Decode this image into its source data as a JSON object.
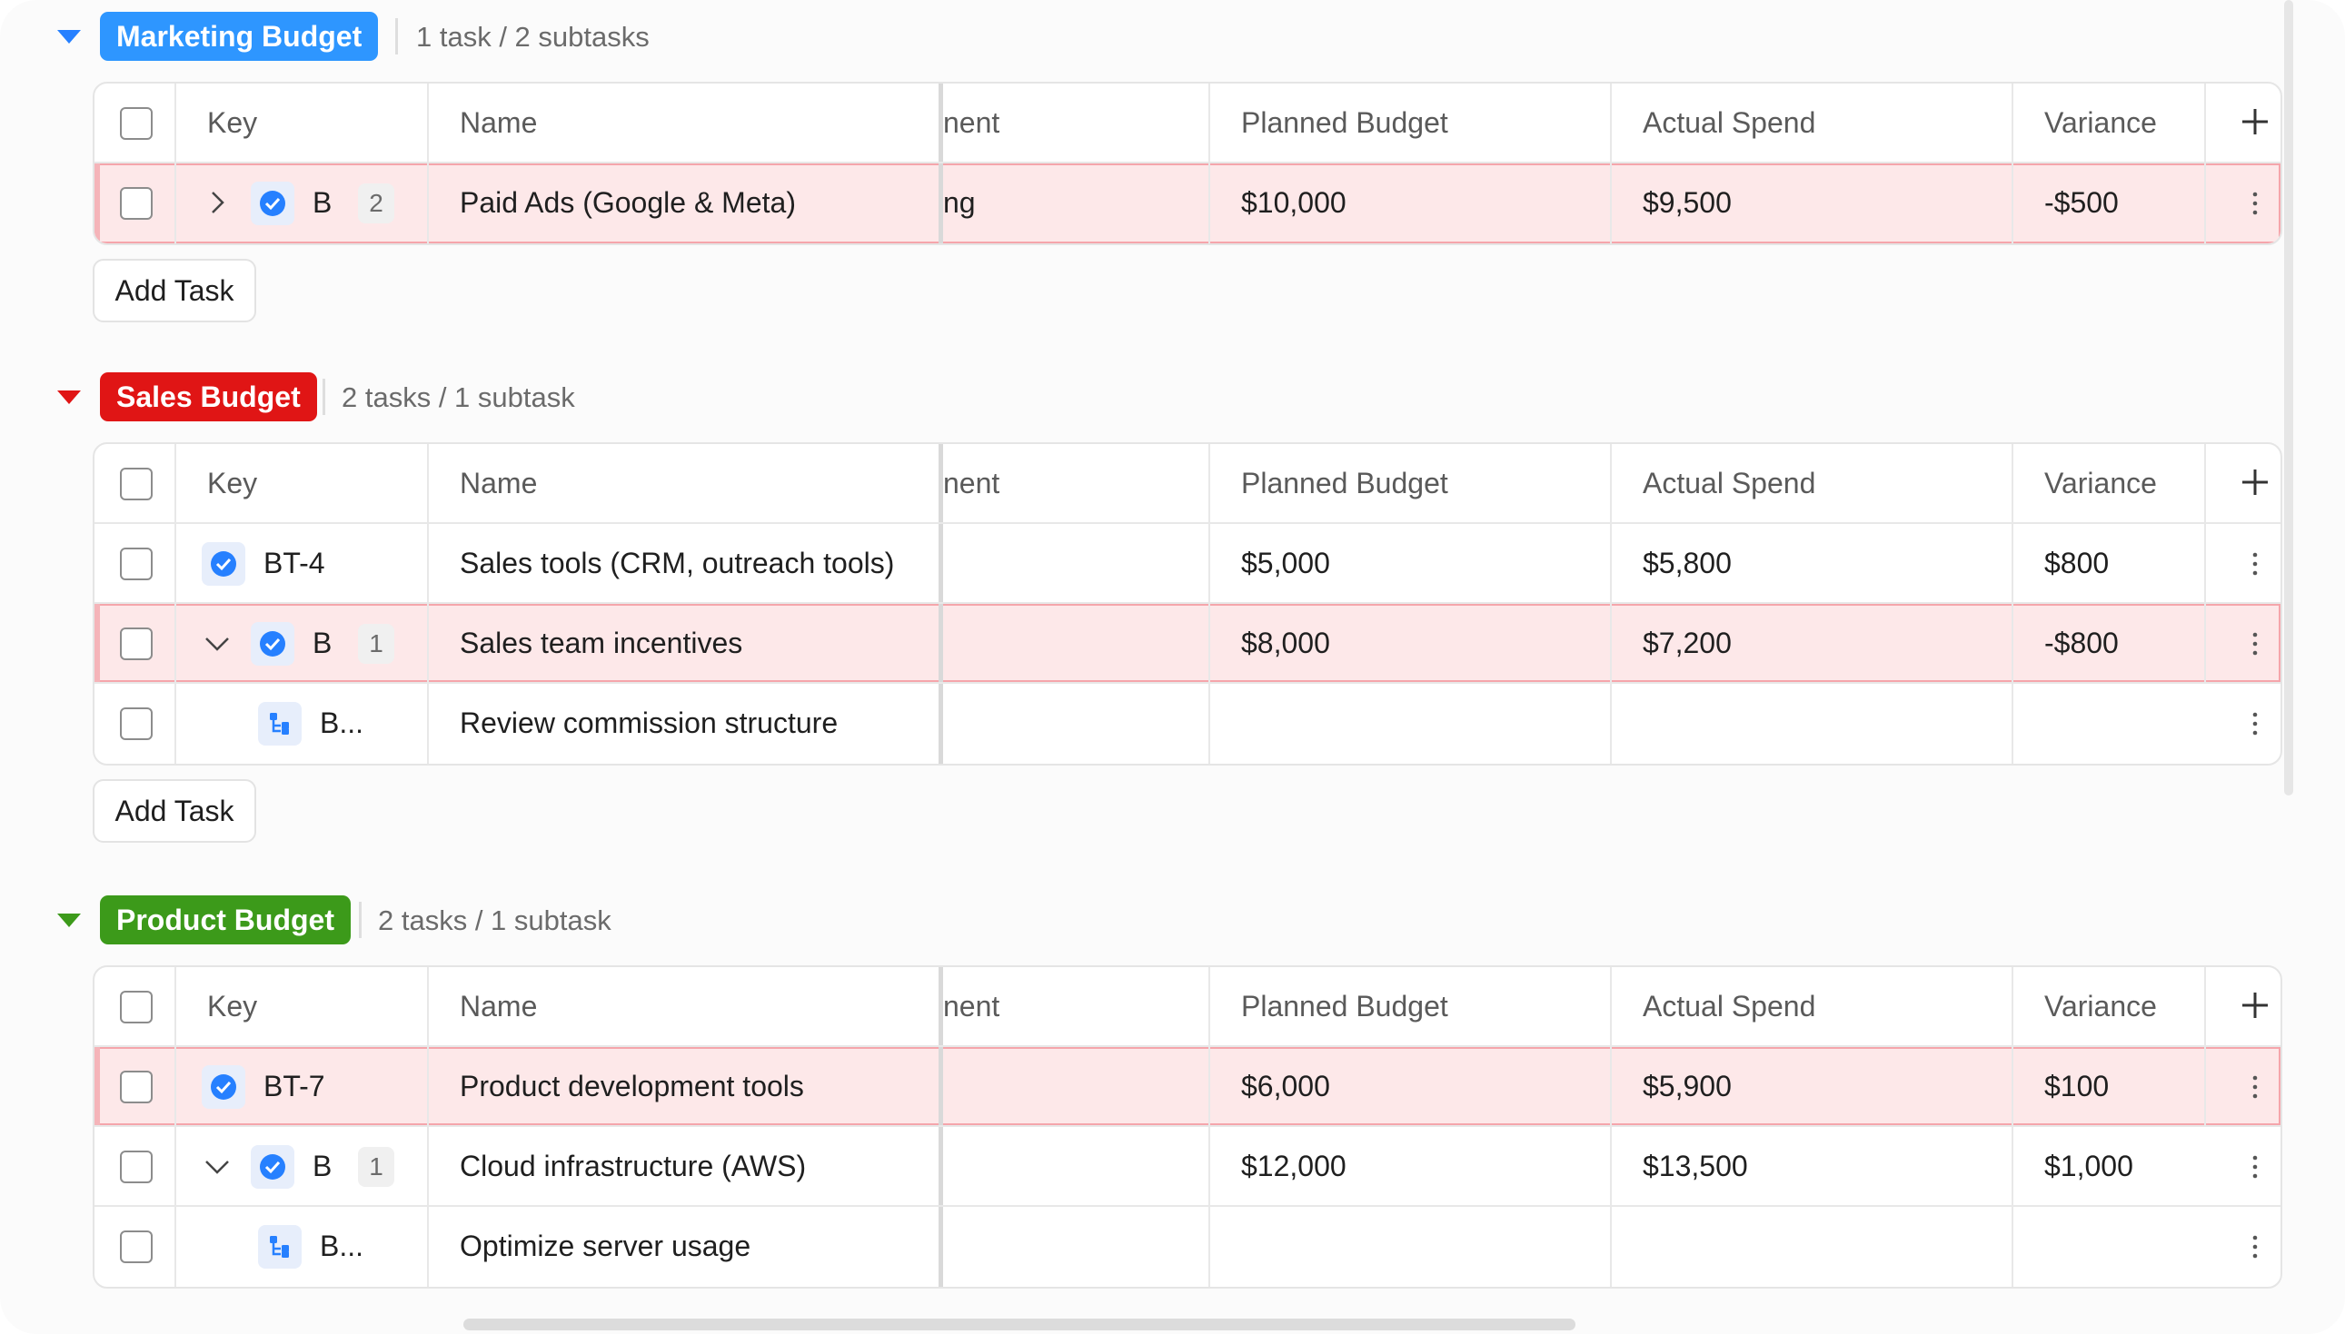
{
  "columns": {
    "key": "Key",
    "name": "Name",
    "department_partial": "nent",
    "planned": "Planned Budget",
    "actual": "Actual Spend",
    "variance": "Variance"
  },
  "add_task_label": "Add Task",
  "colors": {
    "accent": "#2680ff",
    "highlight": "#fde8e9",
    "marketing": "#2e96ff",
    "sales": "#e01515",
    "product": "#3c9a1a"
  },
  "groups": [
    {
      "title": "Marketing Budget",
      "count_text": "1 task / 2 subtasks",
      "rows": [
        {
          "key": "B",
          "subtasks": "2",
          "name": "Paid Ads (Google & Meta)",
          "dept": "ng",
          "planned": "$10,000",
          "actual": "$9,500",
          "variance": "-$500",
          "icon": "check-circle-icon",
          "chevron": "chevron-right-icon"
        }
      ]
    },
    {
      "title": "Sales Budget",
      "count_text": "2 tasks / 1 subtask",
      "rows": [
        {
          "key": "BT-4",
          "name": "Sales tools (CRM, outreach tools)",
          "planned": "$5,000",
          "actual": "$5,800",
          "variance": "$800",
          "icon": "check-circle-icon"
        },
        {
          "key": "B",
          "subtasks": "1",
          "name": "Sales team incentives",
          "planned": "$8,000",
          "actual": "$7,200",
          "variance": "-$800",
          "icon": "check-circle-icon",
          "chevron": "chevron-down-icon"
        },
        {
          "key": "B...",
          "name": "Review commission structure",
          "icon": "subtask-icon"
        }
      ]
    },
    {
      "title": "Product Budget",
      "count_text": "2 tasks / 1 subtask",
      "rows": [
        {
          "key": "BT-7",
          "name": "Product development tools",
          "planned": "$6,000",
          "actual": "$5,900",
          "variance": "$100",
          "icon": "check-circle-icon"
        },
        {
          "key": "B",
          "subtasks": "1",
          "name": "Cloud infrastructure (AWS)",
          "planned": "$12,000",
          "actual": "$13,500",
          "variance": "$1,000",
          "icon": "check-circle-icon",
          "chevron": "chevron-down-icon"
        },
        {
          "key": "B...",
          "name": "Optimize server usage",
          "icon": "subtask-icon"
        }
      ]
    }
  ]
}
